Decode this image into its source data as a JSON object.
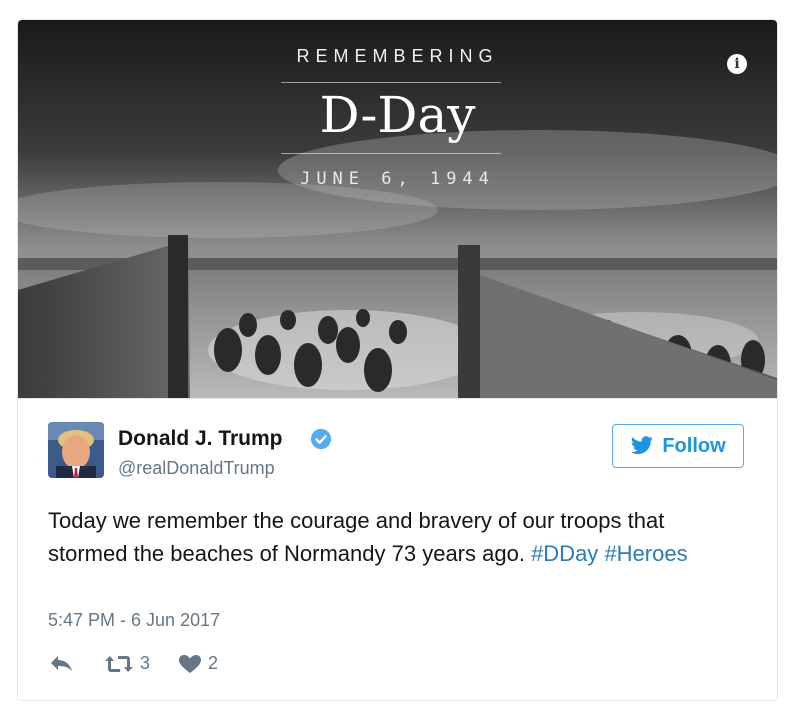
{
  "media": {
    "pre_title": "REMEMBERING",
    "main_title": "D-Day",
    "date": "JUNE 6, 1944",
    "info_icon": "info-icon"
  },
  "author": {
    "name": "Donald J. Trump",
    "handle": "@realDonaldTrump",
    "verified_icon": "verified-badge-icon",
    "avatar": "avatar"
  },
  "follow_button": {
    "label": "Follow",
    "icon": "twitter-bird-icon"
  },
  "tweet": {
    "text_parts": [
      "Today we remember the courage and bravery of our troops that stormed the beaches of Normandy 73 years ago.",
      "#DDay",
      "#Heroes"
    ],
    "timestamp": "5:47 PM - 6 Jun 2017"
  },
  "actions": {
    "reply_icon": "reply-icon",
    "retweet_icon": "retweet-icon",
    "retweet_count": "3",
    "like_icon": "heart-icon",
    "like_count": "2"
  },
  "colors": {
    "link": "#2b7bb9",
    "follow": "#1b95e0",
    "muted": "#657786",
    "verified": "#55acee"
  }
}
